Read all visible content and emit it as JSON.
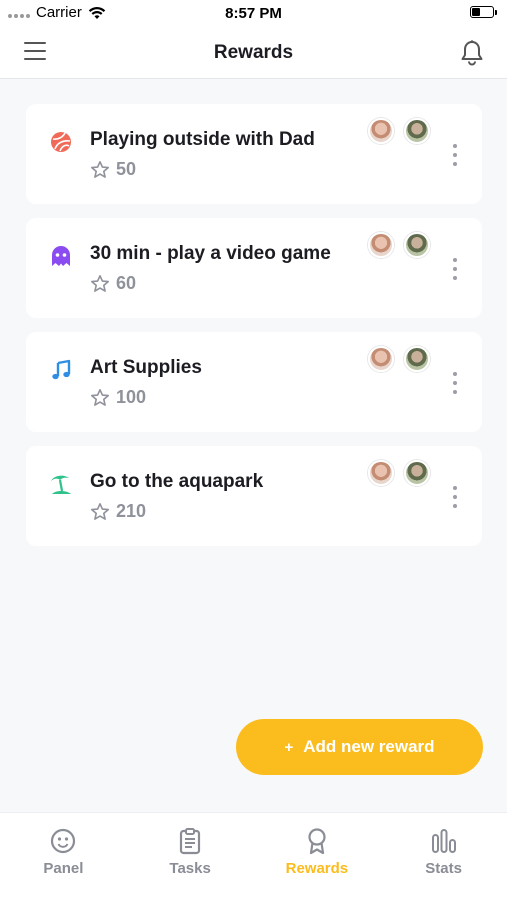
{
  "status_bar": {
    "carrier": "Carrier",
    "time": "8:57 PM",
    "battery_level": 0.4
  },
  "header": {
    "title": "Rewards",
    "menu_icon": "hamburger-menu-icon",
    "notification_icon": "bell-icon"
  },
  "rewards": [
    {
      "title": "Playing outside with Dad",
      "points": "50",
      "icon": "ball-icon",
      "icon_color": "#f06a5a"
    },
    {
      "title": "30 min - play a video game",
      "points": "60",
      "icon": "ghost-icon",
      "icon_color": "#8a4cf0"
    },
    {
      "title": "Art Supplies",
      "points": "100",
      "icon": "music-note-icon",
      "icon_color": "#2f8de4"
    },
    {
      "title": "Go to the aquapark",
      "points": "210",
      "icon": "beach-icon",
      "icon_color": "#2fc28a"
    }
  ],
  "add_button": {
    "plus": "+",
    "label": "Add new reward",
    "color": "#fbbd1d"
  },
  "tabs": [
    {
      "label": "Panel",
      "icon": "smiley-icon",
      "active": false
    },
    {
      "label": "Tasks",
      "icon": "clipboard-icon",
      "active": false
    },
    {
      "label": "Rewards",
      "icon": "medal-icon",
      "active": true
    },
    {
      "label": "Stats",
      "icon": "bar-chart-icon",
      "active": false
    }
  ],
  "colors": {
    "accent": "#fbbd1d",
    "background": "#f7f8fa",
    "inactive_tab": "#8a8d95"
  }
}
